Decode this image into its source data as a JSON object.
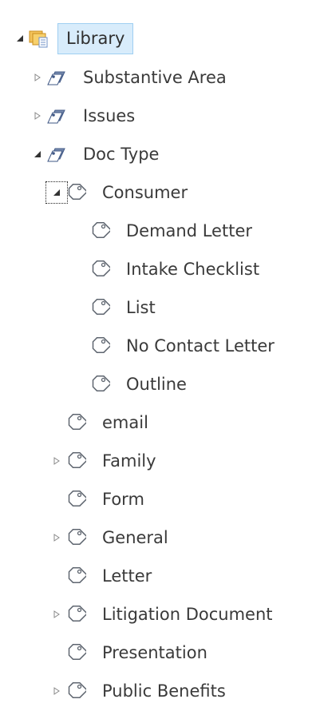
{
  "tree": {
    "root": {
      "label": "Library",
      "expanded": true
    },
    "items": [
      {
        "label": "Substantive Area",
        "expanded": false,
        "icon": "term-set-icon"
      },
      {
        "label": "Issues",
        "expanded": false,
        "icon": "term-set-icon"
      },
      {
        "label": "Doc Type",
        "expanded": true,
        "icon": "term-set-icon"
      },
      {
        "label": "Consumer",
        "expanded": true,
        "icon": "tag-icon"
      },
      {
        "label": "Demand Letter",
        "icon": "tag-icon"
      },
      {
        "label": "Intake Checklist",
        "icon": "tag-icon"
      },
      {
        "label": "List",
        "icon": "tag-icon"
      },
      {
        "label": "No Contact Letter",
        "icon": "tag-icon"
      },
      {
        "label": "Outline",
        "icon": "tag-icon"
      },
      {
        "label": "email",
        "icon": "tag-icon"
      },
      {
        "label": "Family",
        "expanded": false,
        "icon": "tag-icon"
      },
      {
        "label": "Form",
        "icon": "tag-icon"
      },
      {
        "label": "General",
        "expanded": false,
        "icon": "tag-icon"
      },
      {
        "label": "Letter",
        "icon": "tag-icon"
      },
      {
        "label": "Litigation Document",
        "expanded": false,
        "icon": "tag-icon"
      },
      {
        "label": "Presentation",
        "icon": "tag-icon"
      },
      {
        "label": "Public Benefits",
        "expanded": false,
        "icon": "tag-icon"
      }
    ]
  },
  "colors": {
    "selected_bg": "#d8ecfb",
    "selected_border": "#9fcff2",
    "text": "#3a3a3a"
  }
}
